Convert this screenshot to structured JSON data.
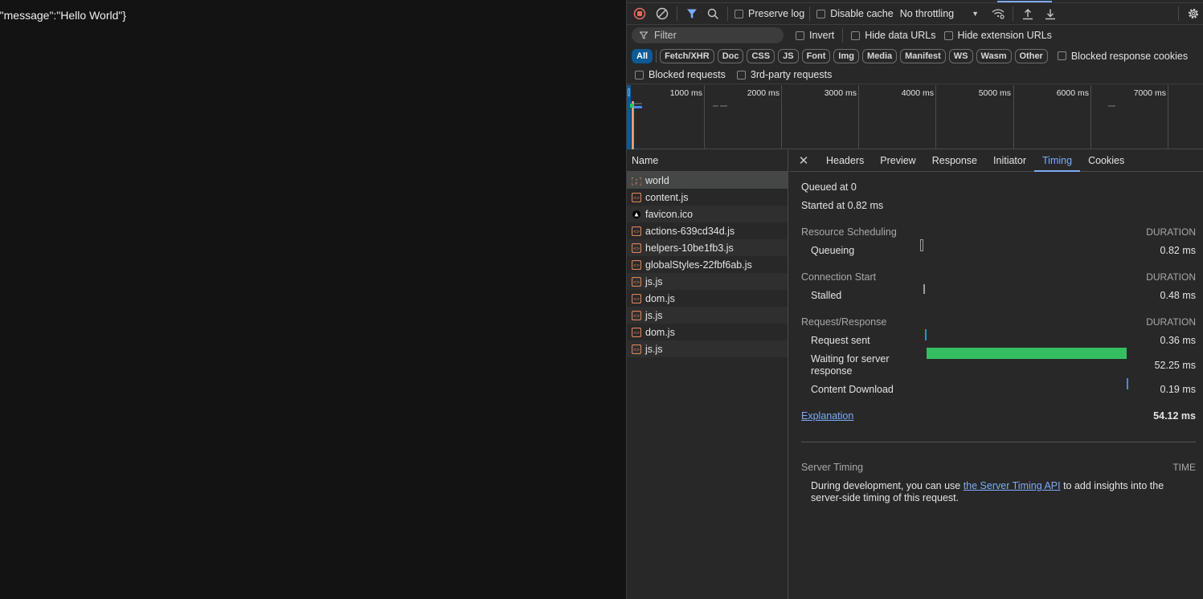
{
  "page": {
    "body_text": "{\"message\":\"Hello World\"}"
  },
  "toolbar": {
    "record_icon": "record-stop-icon",
    "clear_icon": "clear-icon",
    "filter_icon": "filter-icon",
    "search_icon": "search-icon",
    "preserve_log": "Preserve log",
    "disable_cache": "Disable cache",
    "throttling": "No throttling",
    "network_conditions_icon": "wifi-settings-icon",
    "import_icon": "upload-icon",
    "export_icon": "download-icon",
    "settings_icon": "gear-icon"
  },
  "filterbar": {
    "placeholder": "Filter",
    "invert": "Invert",
    "hide_data_urls": "Hide data URLs",
    "hide_extension_urls": "Hide extension URLs"
  },
  "type_filters": [
    "All",
    "Fetch/XHR",
    "Doc",
    "CSS",
    "JS",
    "Font",
    "Img",
    "Media",
    "Manifest",
    "WS",
    "Wasm",
    "Other"
  ],
  "type_filter_active": "All",
  "blocked_response_cookies": "Blocked response cookies",
  "blocked_requests": "Blocked requests",
  "third_party_requests": "3rd-party requests",
  "timeline": {
    "ticks": [
      "1000 ms",
      "2000 ms",
      "3000 ms",
      "4000 ms",
      "5000 ms",
      "6000 ms",
      "7000 ms"
    ]
  },
  "requests": {
    "header": "Name",
    "items": [
      {
        "name": "world",
        "type": "json",
        "selected": true
      },
      {
        "name": "content.js",
        "type": "script"
      },
      {
        "name": "favicon.ico",
        "type": "image"
      },
      {
        "name": "actions-639cd34d.js",
        "type": "script"
      },
      {
        "name": "helpers-10be1fb3.js",
        "type": "script"
      },
      {
        "name": "globalStyles-22fbf6ab.js",
        "type": "script"
      },
      {
        "name": "js.js",
        "type": "script"
      },
      {
        "name": "dom.js",
        "type": "script"
      },
      {
        "name": "js.js",
        "type": "script"
      },
      {
        "name": "dom.js",
        "type": "script"
      },
      {
        "name": "js.js",
        "type": "script"
      }
    ]
  },
  "detail": {
    "tabs": [
      "Headers",
      "Preview",
      "Response",
      "Initiator",
      "Timing",
      "Cookies"
    ],
    "active_tab": "Timing",
    "queued_at": "Queued at 0",
    "started_at": "Started at 0.82 ms",
    "sections": [
      {
        "title": "Resource Scheduling",
        "col": "DURATION",
        "rows": [
          {
            "label": "Queueing",
            "duration": "0.82 ms",
            "value_ms": 0.82,
            "color": "#9e9e9e"
          }
        ]
      },
      {
        "title": "Connection Start",
        "col": "DURATION",
        "rows": [
          {
            "label": "Stalled",
            "duration": "0.48 ms",
            "value_ms": 0.48,
            "color": "#9e9e9e"
          }
        ]
      },
      {
        "title": "Request/Response",
        "col": "DURATION",
        "rows": [
          {
            "label": "Request sent",
            "duration": "0.36 ms",
            "value_ms": 0.36,
            "color": "#1a9bc4"
          },
          {
            "label": "Waiting for server response",
            "duration": "52.25 ms",
            "value_ms": 52.25,
            "color": "#35bd62"
          },
          {
            "label": "Content Download",
            "duration": "0.19 ms",
            "value_ms": 0.19,
            "color": "#4f86e8"
          }
        ]
      }
    ],
    "explanation": "Explanation",
    "total": "54.12 ms",
    "server_timing": {
      "title": "Server Timing",
      "col": "TIME",
      "text_before": "During development, you can use ",
      "link": "the Server Timing API",
      "text_after": " to add insights into the",
      "text_line2": "server-side timing of this request."
    }
  }
}
